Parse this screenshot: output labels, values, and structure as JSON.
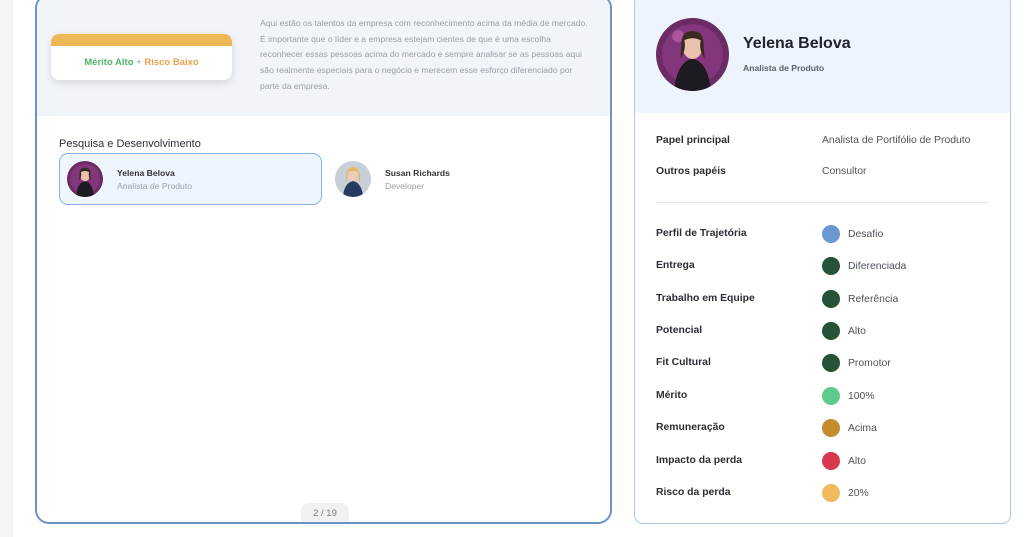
{
  "left_panel": {
    "tag": {
      "part1": "Mérito Alto",
      "plus": "+",
      "part2": "Risco Baixo"
    },
    "description": "Aqui estão os talentos da empresa com reconhecimento acima da média de mercado. É importante que o líder e a empresa estejam cientes de que é uma escolha reconhecer essas pessoas acima do mercado e sempre analisar se as pessoas aqui são realmente especiais para o negócio e merecem esse esforço diferenciado por parte da empresa.",
    "section_title": "Pesquisa e Desenvolvimento",
    "people": [
      {
        "name": "Yelena Belova",
        "role": "Analista de Produto"
      },
      {
        "name": "Susan Richards",
        "role": "Developer"
      }
    ],
    "pagination": "2 / 19"
  },
  "profile": {
    "name": "Yelena Belova",
    "role": "Analista de Produto",
    "papel_principal_label": "Papel principal",
    "papel_principal_value": "Analista de Portifólio de Produto",
    "outros_papeis_label": "Outros papéis",
    "outros_papeis_value": "Consultor",
    "metrics": [
      {
        "label": "Perfil de Trajetória",
        "value": "Desafio",
        "color": "#6b98d1"
      },
      {
        "label": "Entrega",
        "value": "Diferenciada",
        "color": "#255238"
      },
      {
        "label": "Trabalho em Equipe",
        "value": "Referência",
        "color": "#255238"
      },
      {
        "label": "Potencial",
        "value": "Alto",
        "color": "#255238"
      },
      {
        "label": "Fit Cultural",
        "value": "Promotor",
        "color": "#255238"
      },
      {
        "label": "Mérito",
        "value": "100%",
        "color": "#5ecb8c"
      },
      {
        "label": "Remuneração",
        "value": "Acima",
        "color": "#c48c2a"
      },
      {
        "label": "Impacto da perda",
        "value": "Alto",
        "color": "#d63a4c"
      },
      {
        "label": "Risco da perda",
        "value": "20%",
        "color": "#f0ba5e"
      }
    ]
  }
}
